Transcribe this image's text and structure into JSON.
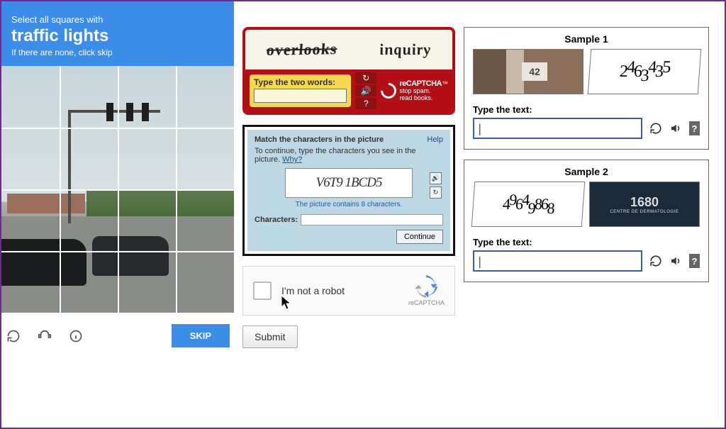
{
  "grid_captcha": {
    "line1": "Select all squares with",
    "target": "traffic lights",
    "line3": "If there are none, click skip",
    "skip_label": "SKIP"
  },
  "recaptcha_v1": {
    "word1": "overlooks",
    "word2": "inquiry",
    "prompt": "Type the two words:",
    "brand_name": "reCAPTCHA",
    "tagline1": "stop spam.",
    "tagline2": "read books."
  },
  "match_chars": {
    "title": "Match the characters in the picture",
    "help": "Help",
    "subtitle_prefix": "To continue, type the characters you see in the picture.",
    "why": "Why?",
    "distorted": "V6T9 1BCD5",
    "note": "The picture contains 8 characters.",
    "field_label": "Characters:",
    "continue_label": "Continue"
  },
  "recaptcha_v2": {
    "label": "I'm not a robot",
    "brand": "reCAPTCHA"
  },
  "submit": {
    "label": "Submit"
  },
  "samples": [
    {
      "title": "Sample 1",
      "photo_number": "42",
      "digits": "2463435",
      "prompt": "Type the text:",
      "value": "|"
    },
    {
      "title": "Sample 2",
      "digits": "49649868",
      "photo_big": "1680",
      "photo_small": "CENTRE DE DERMATOLOGIE",
      "prompt": "Type the text:",
      "value": "|"
    }
  ]
}
